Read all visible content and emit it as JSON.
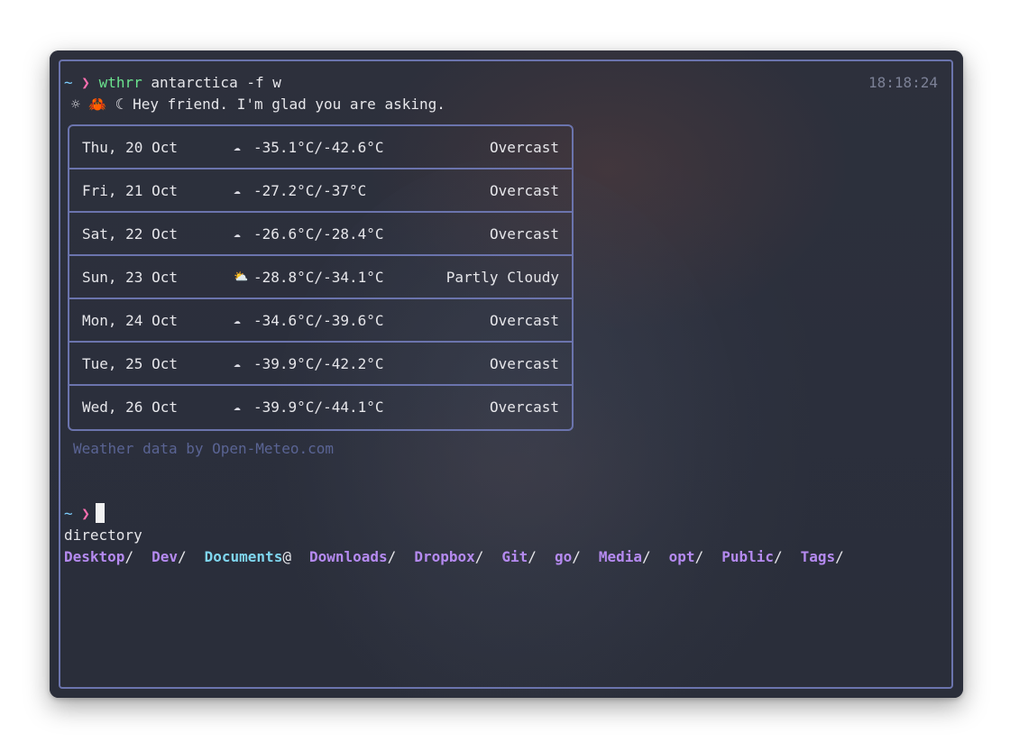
{
  "terminal": {
    "prompt_tilde": "~",
    "prompt_char": "❯",
    "command_name": "wthrr",
    "command_args": " antarctica -f w",
    "clock": "18:18:24",
    "greeting_icons": "☼ 🦀 ☾",
    "greeting_text": "Hey friend. I'm glad you are asking.",
    "forecast": [
      {
        "date": "Thu, 20 Oct",
        "icon": "☁",
        "temp": "-35.1°C/-42.6°C",
        "condition": "Overcast"
      },
      {
        "date": "Fri, 21 Oct",
        "icon": "☁",
        "temp": "-27.2°C/-37°C",
        "condition": "Overcast"
      },
      {
        "date": "Sat, 22 Oct",
        "icon": "☁",
        "temp": "-26.6°C/-28.4°C",
        "condition": "Overcast"
      },
      {
        "date": "Sun, 23 Oct",
        "icon": "⛅",
        "temp": "-28.8°C/-34.1°C",
        "condition": "Partly Cloudy"
      },
      {
        "date": "Mon, 24 Oct",
        "icon": "☁",
        "temp": "-34.6°C/-39.6°C",
        "condition": "Overcast"
      },
      {
        "date": "Tue, 25 Oct",
        "icon": "☁",
        "temp": "-39.9°C/-42.2°C",
        "condition": "Overcast"
      },
      {
        "date": "Wed, 26 Oct",
        "icon": "☁",
        "temp": "-39.9°C/-44.1°C",
        "condition": "Overcast"
      }
    ],
    "credit": "Weather data by Open-Meteo.com",
    "second_prompt_tilde": "~",
    "second_prompt_char": "❯",
    "directory_label": "directory",
    "directories": [
      {
        "name": "Desktop",
        "suffix": "/",
        "kind": "dir"
      },
      {
        "name": "Dev",
        "suffix": "/",
        "kind": "dir"
      },
      {
        "name": "Documents",
        "suffix": "@",
        "kind": "link"
      },
      {
        "name": "Downloads",
        "suffix": "/",
        "kind": "dir"
      },
      {
        "name": "Dropbox",
        "suffix": "/",
        "kind": "dir"
      },
      {
        "name": "Git",
        "suffix": "/",
        "kind": "dir"
      },
      {
        "name": "go",
        "suffix": "/",
        "kind": "dir"
      },
      {
        "name": "Media",
        "suffix": "/",
        "kind": "dir"
      },
      {
        "name": "opt",
        "suffix": "/",
        "kind": "dir"
      },
      {
        "name": "Public",
        "suffix": "/",
        "kind": "dir"
      },
      {
        "name": "Tags",
        "suffix": "/",
        "kind": "dir"
      }
    ],
    "colors": {
      "accent_border": "#6b74ad",
      "command": "#6be38e",
      "prompt": "#ff6fb0",
      "directory": "#b58af0",
      "symlink": "#7fd6ef",
      "credit": "#5a6494"
    }
  }
}
